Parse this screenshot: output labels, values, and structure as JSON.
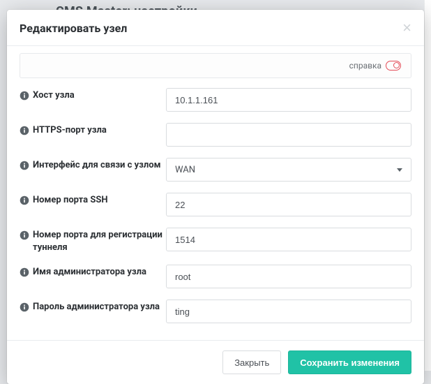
{
  "backdrop_title": "CMS Master: настройки",
  "modal": {
    "title": "Редактировать узел",
    "help_label": "справка"
  },
  "fields": {
    "host": {
      "label": "Хост узла",
      "value": "10.1.1.161"
    },
    "https_port": {
      "label": "HTTPS-порт узла",
      "value": ""
    },
    "interface": {
      "label": "Интерфейс для связи с узлом",
      "value": "WAN"
    },
    "ssh_port": {
      "label": "Номер порта SSH",
      "value": "22"
    },
    "tunnel_port": {
      "label": "Номер порта для регистрации туннеля",
      "value": "1514"
    },
    "admin_user": {
      "label": "Имя администратора узла",
      "value": "root"
    },
    "admin_pass": {
      "label": "Пароль администратора узла",
      "value": "ting"
    }
  },
  "footer": {
    "close": "Закрыть",
    "save": "Сохранить изменения"
  }
}
